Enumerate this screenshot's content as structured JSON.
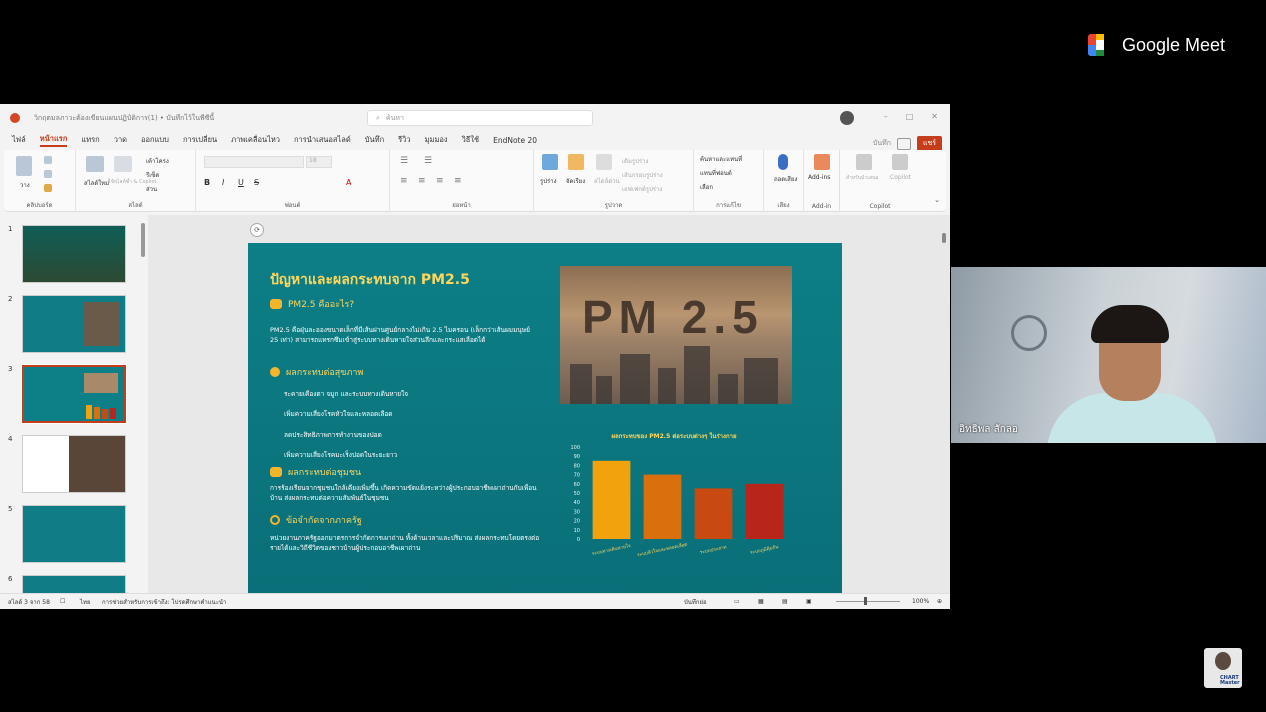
{
  "meet": {
    "brand": "Google Meet"
  },
  "window": {
    "title": "วิกฤตมลภาวะต้องเขียนแผนปฏิบัติการ(1) • บันทึกไว้ในพีซีนี้",
    "search_placeholder": "ค้นหา",
    "record_label": "บันทึก",
    "share_label": "แชร์"
  },
  "tabs": [
    "ไฟล์",
    "หน้าแรก",
    "แทรก",
    "วาด",
    "ออกแบบ",
    "การเปลี่ยน",
    "ภาพเคลื่อนไหว",
    "การนำเสนอสไลด์",
    "บันทึก",
    "รีวิว",
    "มุมมอง",
    "วิธีใช้",
    "EndNote 20"
  ],
  "ribbon": {
    "groups": [
      "คลิปบอร์ด",
      "สไลด์",
      "ฟอนต์",
      "ย่อหน้า",
      "รูปวาด",
      "การแก้ไข",
      "เสียง",
      "Add-in",
      "Copilot"
    ],
    "paste": "วาง",
    "new_slide": "สไลด์ใหม่",
    "reuse_slide": "ใช้สไลด์ซ้ำ & Copilot",
    "layout": "เค้าโครง",
    "reset": "รีเซ็ต",
    "section": "ส่วน",
    "font_size": "18",
    "shapes": "รูปร่าง",
    "arrange": "จัดเรียง",
    "quick_styles": "สไตล์ด่วน",
    "shape_fill": "เติมรูปร่าง",
    "shape_outline": "เส้นกรอบรูปร่าง",
    "shape_effects": "เอฟเฟกต์รูปร่าง",
    "find": "ค้นหาและแทนที่",
    "replace": "แทนที่ฟอนต์",
    "select": "เลือก",
    "dictate": "ถอดเสียง",
    "addins": "Add-ins",
    "copilot_a": "สำหรับนำเสนอ",
    "copilot_b": "Copilot"
  },
  "thumbnails": {
    "numbers": [
      "1",
      "2",
      "3",
      "4",
      "5",
      "6"
    ],
    "selected": "3"
  },
  "slide": {
    "title": "ปัญหาและผลกระทบจาก PM2.5",
    "h1": "PM2.5 คืออะไร?",
    "p1": "PM2.5 คือฝุ่นละอองขนาดเล็กที่มีเส้นผ่านศูนย์กลางไม่เกิน 2.5 ไมครอน (เล็กกว่าเส้นผมมนุษย์ 25 เท่า) สามารถแทรกซึมเข้าสู่ระบบทางเดินหายใจส่วนลึกและกระแสเลือดได้",
    "h2": "ผลกระทบต่อสุขภาพ",
    "items": [
      "ระคายเคืองตา จมูก และระบบทางเดินหายใจ",
      "เพิ่มความเสี่ยงโรคหัวใจและหลอดเลือด",
      "ลดประสิทธิภาพการทำงานของปอด",
      "เพิ่มความเสี่ยงโรคมะเร็งปอดในระยะยาว"
    ],
    "h3": "ผลกระทบต่อชุมชน",
    "p2": "การร้องเรียนจากชุมชนใกล้เคียงเพิ่มขึ้น เกิดความขัดแย้งระหว่างผู้ประกอบอาชีพเผาถ่านกับเพื่อนบ้าน ส่งผลกระทบต่อความสัมพันธ์ในชุมชน",
    "h4": "ข้อจำกัดจากภาครัฐ",
    "p3": "หน่วยงานภาครัฐออกมาตรการจำกัดการเผาถ่าน ทั้งด้านเวลาและปริมาณ ส่งผลกระทบโดยตรงต่อรายได้และวิถีชีวิตของชาวบ้านผู้ประกอบอาชีพเผาถ่าน",
    "image_text": "PM 2.5"
  },
  "chart_data": {
    "type": "bar",
    "title": "ผลกระทบของ PM2.5 ต่อระบบต่างๆ ในร่างกาย",
    "categories": [
      "ระบบทางเดินหายใจ",
      "ระบบหัวใจและหลอดเลือด",
      "ระบบประสาท",
      "ระบบภูมิคุ้มกัน"
    ],
    "values": [
      85,
      70,
      55,
      60
    ],
    "colors": [
      "#f2a20c",
      "#d9700d",
      "#c84a10",
      "#b8251a"
    ],
    "yticks": [
      "0",
      "10",
      "20",
      "30",
      "40",
      "50",
      "60",
      "70",
      "80",
      "90",
      "100"
    ],
    "ylim": [
      0,
      100
    ]
  },
  "status": {
    "slide_pos": "สไลด์ 3 จาก 58",
    "language": "ไทย",
    "accessibility": "การช่วยสำหรับการเข้าถึง: โปรดศึกษาคำแนะนำ",
    "notes": "บันทึกย่อ",
    "zoom": "100%"
  },
  "participant": {
    "name": "อิทธิพล สักลอ"
  },
  "self_view": {
    "label": "CHART Master"
  }
}
